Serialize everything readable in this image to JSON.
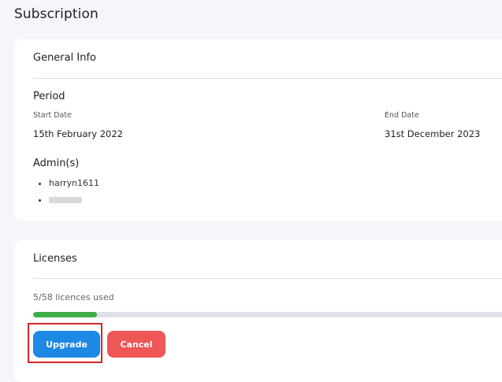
{
  "page": {
    "title": "Subscription"
  },
  "general_info": {
    "header": "General Info",
    "period": {
      "heading": "Period",
      "start_label": "Start Date",
      "start_value": "15th February 2022",
      "end_label": "End Date",
      "end_value": "31st December 2023"
    },
    "admins": {
      "heading": "Admin(s)",
      "items": [
        "harryn1611",
        ""
      ]
    }
  },
  "licenses": {
    "header": "Licenses",
    "usage_text": "5/58 licences used",
    "used": 5,
    "total": 58,
    "progress_color": "#3fae4a",
    "upgrade_label": "Upgrade",
    "cancel_label": "Cancel",
    "upgrade_color": "#1e88e5",
    "cancel_color": "#ef5656",
    "highlight_color": "#d62828"
  }
}
